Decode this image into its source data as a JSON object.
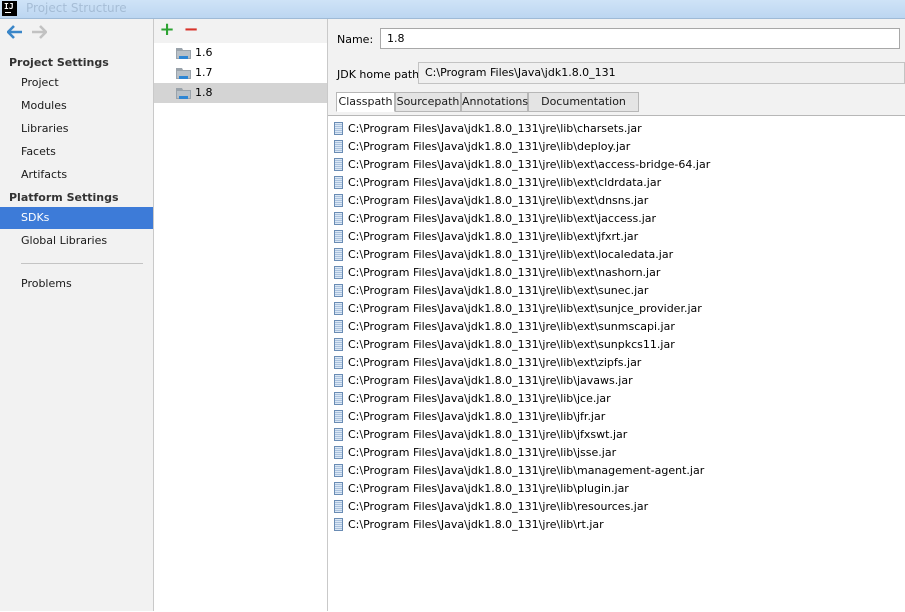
{
  "window": {
    "title": "Project Structure",
    "logo": "IJ"
  },
  "nav": {
    "project_settings_header": "Project Settings",
    "project_items": [
      "Project",
      "Modules",
      "Libraries",
      "Facets",
      "Artifacts"
    ],
    "platform_settings_header": "Platform Settings",
    "platform_items": [
      "SDKs",
      "Global Libraries"
    ],
    "other_items": [
      "Problems"
    ],
    "selected": "SDKs",
    "icons": {
      "back": "back-arrow-icon",
      "forward": "forward-arrow-icon"
    }
  },
  "sdk_list": {
    "items": [
      "1.6",
      "1.7",
      "1.8"
    ],
    "selected": "1.8",
    "toolbar": {
      "add": "+",
      "remove": "−"
    }
  },
  "detail": {
    "name_label": "Name:",
    "name_value": "1.8",
    "jdk_home_label": "JDK home path:",
    "jdk_home_value": "C:\\Program Files\\Java\\jdk1.8.0_131",
    "tabs": [
      "Classpath",
      "Sourcepath",
      "Annotations",
      "Documentation Paths"
    ],
    "active_tab": "Classpath",
    "classpath": [
      "C:\\Program Files\\Java\\jdk1.8.0_131\\jre\\lib\\charsets.jar",
      "C:\\Program Files\\Java\\jdk1.8.0_131\\jre\\lib\\deploy.jar",
      "C:\\Program Files\\Java\\jdk1.8.0_131\\jre\\lib\\ext\\access-bridge-64.jar",
      "C:\\Program Files\\Java\\jdk1.8.0_131\\jre\\lib\\ext\\cldrdata.jar",
      "C:\\Program Files\\Java\\jdk1.8.0_131\\jre\\lib\\ext\\dnsns.jar",
      "C:\\Program Files\\Java\\jdk1.8.0_131\\jre\\lib\\ext\\jaccess.jar",
      "C:\\Program Files\\Java\\jdk1.8.0_131\\jre\\lib\\ext\\jfxrt.jar",
      "C:\\Program Files\\Java\\jdk1.8.0_131\\jre\\lib\\ext\\localedata.jar",
      "C:\\Program Files\\Java\\jdk1.8.0_131\\jre\\lib\\ext\\nashorn.jar",
      "C:\\Program Files\\Java\\jdk1.8.0_131\\jre\\lib\\ext\\sunec.jar",
      "C:\\Program Files\\Java\\jdk1.8.0_131\\jre\\lib\\ext\\sunjce_provider.jar",
      "C:\\Program Files\\Java\\jdk1.8.0_131\\jre\\lib\\ext\\sunmscapi.jar",
      "C:\\Program Files\\Java\\jdk1.8.0_131\\jre\\lib\\ext\\sunpkcs11.jar",
      "C:\\Program Files\\Java\\jdk1.8.0_131\\jre\\lib\\ext\\zipfs.jar",
      "C:\\Program Files\\Java\\jdk1.8.0_131\\jre\\lib\\javaws.jar",
      "C:\\Program Files\\Java\\jdk1.8.0_131\\jre\\lib\\jce.jar",
      "C:\\Program Files\\Java\\jdk1.8.0_131\\jre\\lib\\jfr.jar",
      "C:\\Program Files\\Java\\jdk1.8.0_131\\jre\\lib\\jfxswt.jar",
      "C:\\Program Files\\Java\\jdk1.8.0_131\\jre\\lib\\jsse.jar",
      "C:\\Program Files\\Java\\jdk1.8.0_131\\jre\\lib\\management-agent.jar",
      "C:\\Program Files\\Java\\jdk1.8.0_131\\jre\\lib\\plugin.jar",
      "C:\\Program Files\\Java\\jdk1.8.0_131\\jre\\lib\\resources.jar",
      "C:\\Program Files\\Java\\jdk1.8.0_131\\jre\\lib\\rt.jar"
    ]
  },
  "colors": {
    "selection_blue": "#3d7bd8",
    "sdk_selection": "#d4d4d4",
    "add_green": "#2da333",
    "remove_red": "#d8332a",
    "arrow_blue": "#3a86c8"
  }
}
